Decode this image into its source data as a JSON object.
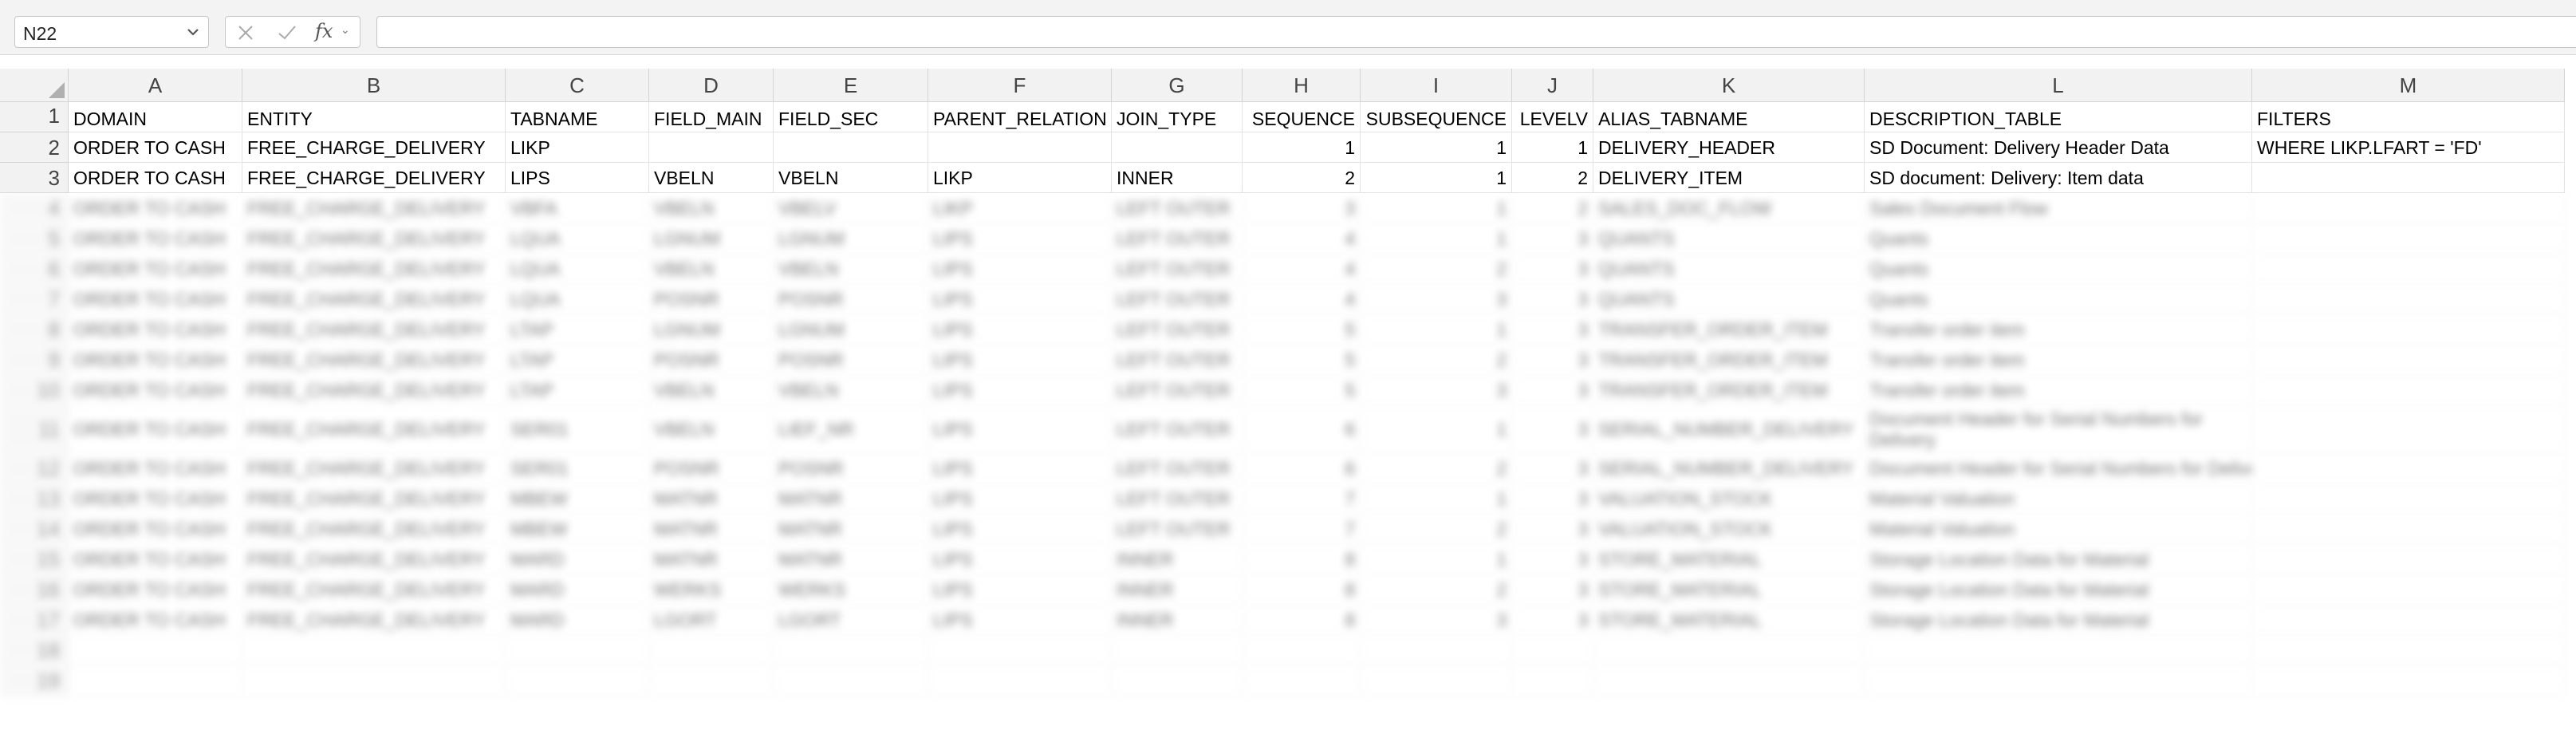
{
  "name_box": {
    "value": "N22"
  },
  "formula": {
    "fx_label": "fx",
    "value": ""
  },
  "columns": [
    "A",
    "B",
    "C",
    "D",
    "E",
    "F",
    "G",
    "H",
    "I",
    "J",
    "K",
    "L",
    "M"
  ],
  "rows": [
    {
      "num": "1",
      "cells": [
        "DOMAIN",
        "ENTITY",
        "TABNAME",
        "FIELD_MAIN",
        "FIELD_SEC",
        "PARENT_RELATION",
        "JOIN_TYPE",
        "SEQUENCE",
        "SUBSEQUENCE",
        "LEVELV",
        "ALIAS_TABNAME",
        "DESCRIPTION_TABLE",
        "FILTERS"
      ]
    },
    {
      "num": "2",
      "cells": [
        "ORDER TO CASH",
        "FREE_CHARGE_DELIVERY",
        "LIKP",
        "",
        "",
        "",
        "",
        "1",
        "1",
        "1",
        "DELIVERY_HEADER",
        "SD Document: Delivery Header Data",
        "WHERE LIKP.LFART = 'FD'"
      ]
    },
    {
      "num": "3",
      "cells": [
        "ORDER TO CASH",
        "FREE_CHARGE_DELIVERY",
        "LIPS",
        "VBELN",
        "VBELN",
        "LIKP",
        "INNER",
        "2",
        "1",
        "2",
        "DELIVERY_ITEM",
        "SD document: Delivery: Item data",
        ""
      ]
    },
    {
      "num": "4",
      "cells": [
        "ORDER TO CASH",
        "FREE_CHARGE_DELIVERY",
        "VBFA",
        "VBELN",
        "VBELV",
        "LIKP",
        "LEFT OUTER",
        "3",
        "1",
        "2",
        "SALES_DOC_FLOW",
        "Sales Document Flow",
        ""
      ]
    },
    {
      "num": "5",
      "cells": [
        "ORDER TO CASH",
        "FREE_CHARGE_DELIVERY",
        "LQUA",
        "LGNUM",
        "LGNUM",
        "LIPS",
        "LEFT OUTER",
        "4",
        "1",
        "3",
        "QUANTS",
        "Quants",
        ""
      ]
    },
    {
      "num": "6",
      "cells": [
        "ORDER TO CASH",
        "FREE_CHARGE_DELIVERY",
        "LQUA",
        "VBELN",
        "VBELN",
        "LIPS",
        "LEFT OUTER",
        "4",
        "2",
        "3",
        "QUANTS",
        "Quants",
        ""
      ]
    },
    {
      "num": "7",
      "cells": [
        "ORDER TO CASH",
        "FREE_CHARGE_DELIVERY",
        "LQUA",
        "POSNR",
        "POSNR",
        "LIPS",
        "LEFT OUTER",
        "4",
        "3",
        "3",
        "QUANTS",
        "Quants",
        ""
      ]
    },
    {
      "num": "8",
      "cells": [
        "ORDER TO CASH",
        "FREE_CHARGE_DELIVERY",
        "LTAP",
        "LGNUM",
        "LGNUM",
        "LIPS",
        "LEFT OUTER",
        "5",
        "1",
        "3",
        "TRANSFER_ORDER_ITEM",
        "Transfer order item",
        ""
      ]
    },
    {
      "num": "9",
      "cells": [
        "ORDER TO CASH",
        "FREE_CHARGE_DELIVERY",
        "LTAP",
        "POSNR",
        "POSNR",
        "LIPS",
        "LEFT OUTER",
        "5",
        "2",
        "3",
        "TRANSFER_ORDER_ITEM",
        "Transfer order item",
        ""
      ]
    },
    {
      "num": "10",
      "cells": [
        "ORDER TO CASH",
        "FREE_CHARGE_DELIVERY",
        "LTAP",
        "VBELN",
        "VBELN",
        "LIPS",
        "LEFT OUTER",
        "5",
        "3",
        "3",
        "TRANSFER_ORDER_ITEM",
        "Transfer order item",
        ""
      ]
    },
    {
      "num": "11",
      "cells": [
        "ORDER TO CASH",
        "FREE_CHARGE_DELIVERY",
        "SER01",
        "VBELN",
        "LIEF_NR",
        "LIPS",
        "LEFT OUTER",
        "6",
        "1",
        "3",
        "SERIAL_NUMBER_DELIVERY",
        "Document Header for Serial Numbers for Delivery",
        ""
      ]
    },
    {
      "num": "12",
      "cells": [
        "ORDER TO CASH",
        "FREE_CHARGE_DELIVERY",
        "SER01",
        "POSNR",
        "POSNR",
        "LIPS",
        "LEFT OUTER",
        "6",
        "2",
        "3",
        "SERIAL_NUMBER_DELIVERY",
        "Document Header for Serial Numbers for Delivery",
        ""
      ]
    },
    {
      "num": "13",
      "cells": [
        "ORDER TO CASH",
        "FREE_CHARGE_DELIVERY",
        "MBEW",
        "MATNR",
        "MATNR",
        "LIPS",
        "LEFT OUTER",
        "7",
        "1",
        "3",
        "VALUATION_STOCK",
        "Material Valuation",
        ""
      ]
    },
    {
      "num": "14",
      "cells": [
        "ORDER TO CASH",
        "FREE_CHARGE_DELIVERY",
        "MBEW",
        "MATNR",
        "MATNR",
        "LIPS",
        "LEFT OUTER",
        "7",
        "2",
        "3",
        "VALUATION_STOCK",
        "Material Valuation",
        ""
      ]
    },
    {
      "num": "15",
      "cells": [
        "ORDER TO CASH",
        "FREE_CHARGE_DELIVERY",
        "MARD",
        "MATNR",
        "MATNR",
        "LIPS",
        "INNER",
        "8",
        "1",
        "3",
        "STORE_MATERIAL",
        "Storage Location Data for Material",
        ""
      ]
    },
    {
      "num": "16",
      "cells": [
        "ORDER TO CASH",
        "FREE_CHARGE_DELIVERY",
        "MARD",
        "WERKS",
        "WERKS",
        "LIPS",
        "INNER",
        "8",
        "2",
        "3",
        "STORE_MATERIAL",
        "Storage Location Data for Material",
        ""
      ]
    },
    {
      "num": "17",
      "cells": [
        "ORDER TO CASH",
        "FREE_CHARGE_DELIVERY",
        "MARD",
        "LGORT",
        "LGORT",
        "LIPS",
        "INNER",
        "8",
        "3",
        "3",
        "STORE_MATERIAL",
        "Storage Location Data for Material",
        ""
      ]
    },
    {
      "num": "18",
      "cells": [
        "",
        "",
        "",
        "",
        "",
        "",
        "",
        "",
        "",
        "",
        "",
        "",
        ""
      ]
    },
    {
      "num": "19",
      "cells": [
        "",
        "",
        "",
        "",
        "",
        "",
        "",
        "",
        "",
        "",
        "",
        "",
        ""
      ]
    }
  ]
}
